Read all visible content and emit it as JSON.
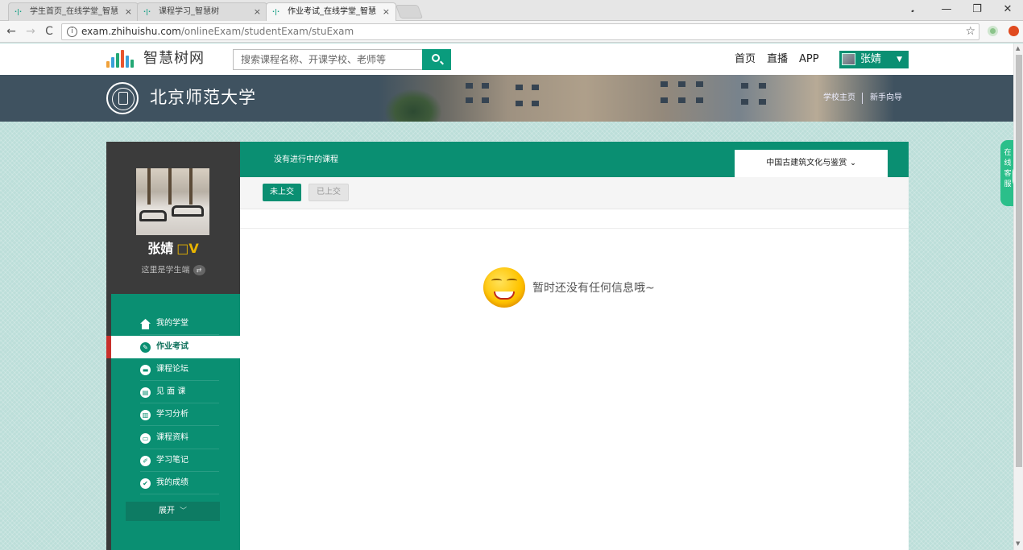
{
  "browser": {
    "tabs": [
      {
        "label": "学生首页_在线学堂_智慧"
      },
      {
        "label": "课程学习_智慧树"
      },
      {
        "label": "作业考试_在线学堂_智慧"
      }
    ],
    "tab_close": "×",
    "favicon": "·|·",
    "url_domain": "exam.zhihuishu.com",
    "url_path": "/onlineExam/studentExam/stuExam",
    "info_icon": "i",
    "back": "←",
    "forward": "→",
    "reload": "C",
    "bookmark": "☆",
    "window_user": "𝅘",
    "minimize": "—",
    "restore": "❐",
    "close": "✕"
  },
  "header": {
    "logo_text": "智慧树网",
    "search_placeholder": "搜索课程名称、开课学校、老师等",
    "nav": [
      "首页",
      "直播",
      "APP"
    ],
    "user_name": "张婧",
    "user_caret": "▼",
    "brand_color": "#0a9c7d"
  },
  "banner": {
    "school_name": "北京师范大学",
    "links": [
      "学校主页",
      "新手向导"
    ]
  },
  "sidebar": {
    "profile_name": "张婧",
    "vip_badge": "□V",
    "role_text": "这里是学生端",
    "swap_icon": "⇄",
    "menu": [
      {
        "label": "我的学堂",
        "icon": "home-icon",
        "active": false
      },
      {
        "label": "作业考试",
        "icon": "pen-icon",
        "active": true
      },
      {
        "label": "课程论坛",
        "icon": "chat-icon",
        "active": false
      },
      {
        "label": "见 面 课",
        "icon": "meeting-icon",
        "active": false
      },
      {
        "label": "学习分析",
        "icon": "chart-icon",
        "active": false
      },
      {
        "label": "课程资料",
        "icon": "folder-icon",
        "active": false
      },
      {
        "label": "学习笔记",
        "icon": "note-icon",
        "active": false
      },
      {
        "label": "我的成绩",
        "icon": "check-icon",
        "active": false
      }
    ],
    "expand_label": "展开",
    "expand_chevron": "﹀"
  },
  "main": {
    "status_text": "没有进行中的课程",
    "course_selected": "中国古建筑文化与鉴赏",
    "course_chevron": "⌄",
    "filters": [
      {
        "label": "未上交",
        "selected": true
      },
      {
        "label": "已上交",
        "selected": false
      }
    ],
    "empty_message": "暂时还没有任何信息哦~"
  },
  "float": {
    "service_chars": [
      "在",
      "线",
      "客",
      "服"
    ]
  },
  "scroll": {
    "up": "▲",
    "down": "▼"
  }
}
